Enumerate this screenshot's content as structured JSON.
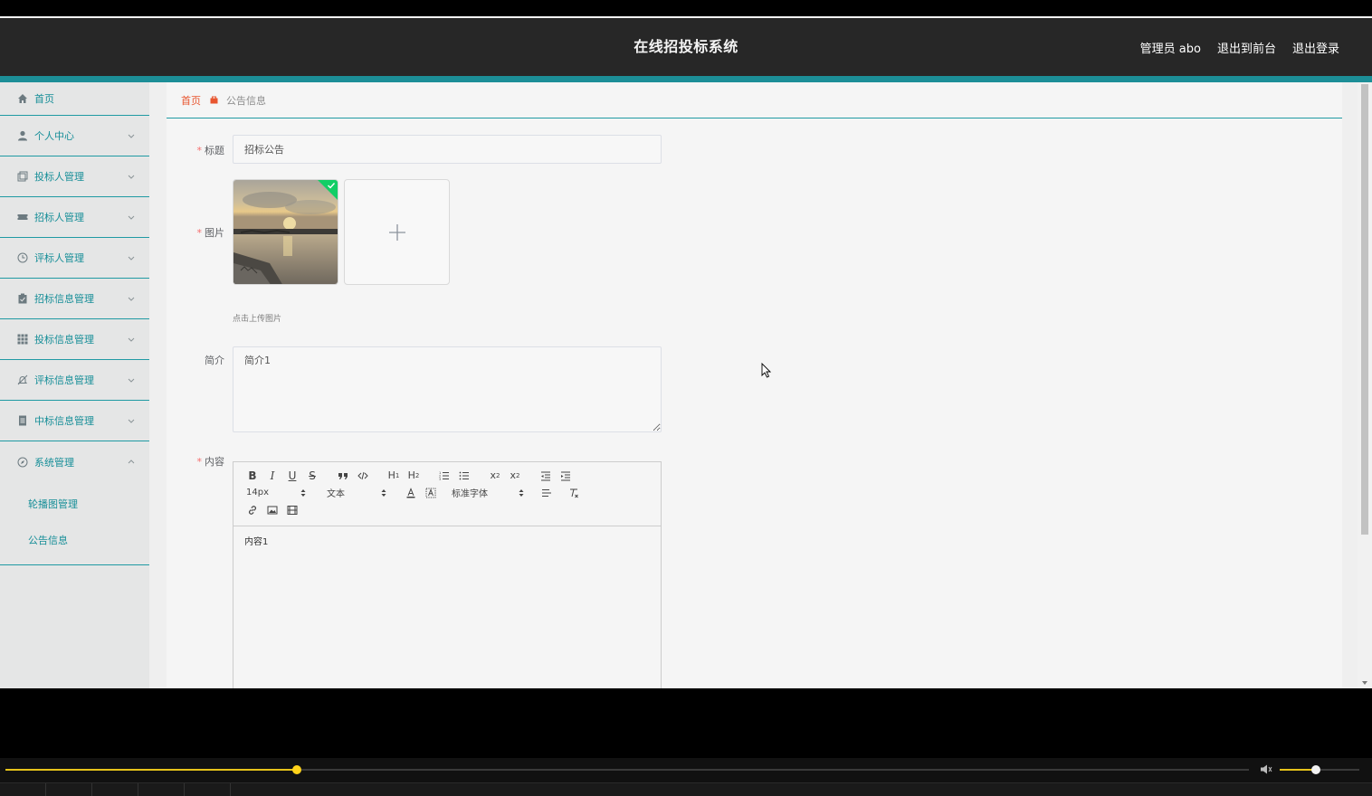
{
  "header": {
    "title": "在线招投标系统",
    "user_label": "管理员 abo",
    "back_to_front": "退出到前台",
    "logout": "退出登录"
  },
  "sidebar": {
    "items": [
      {
        "label": "首页",
        "icon": "home-icon",
        "expandable": false
      },
      {
        "label": "个人中心",
        "icon": "user-icon",
        "expandable": true
      },
      {
        "label": "投标人管理",
        "icon": "copy-icon",
        "expandable": true
      },
      {
        "label": "招标人管理",
        "icon": "ticket-icon",
        "expandable": true
      },
      {
        "label": "评标人管理",
        "icon": "clock-icon",
        "expandable": true
      },
      {
        "label": "招标信息管理",
        "icon": "clipboard-icon",
        "expandable": true
      },
      {
        "label": "投标信息管理",
        "icon": "grid-icon",
        "expandable": true
      },
      {
        "label": "评标信息管理",
        "icon": "bell-off-icon",
        "expandable": true
      },
      {
        "label": "中标信息管理",
        "icon": "document-icon",
        "expandable": true
      },
      {
        "label": "系统管理",
        "icon": "compass-icon",
        "expandable": true,
        "expanded": true
      }
    ],
    "sub_items": [
      "轮播图管理",
      "公告信息"
    ]
  },
  "breadcrumb": {
    "home": "首页",
    "current": "公告信息"
  },
  "form": {
    "title_label": "标题",
    "title_value": "招标公告",
    "image_label": "图片",
    "upload_hint": "点击上传图片",
    "intro_label": "简介",
    "intro_value": "简介1",
    "content_label": "内容",
    "content_value": "内容1"
  },
  "editor_toolbar": {
    "size": "14px",
    "header": "文本",
    "font": "标准字体"
  },
  "player": {
    "progress": 0.234,
    "volume": 0.45
  },
  "colors": {
    "accent": "#1c8e97",
    "header_bg": "#272727",
    "breadcrumb_home": "#e8552f"
  }
}
